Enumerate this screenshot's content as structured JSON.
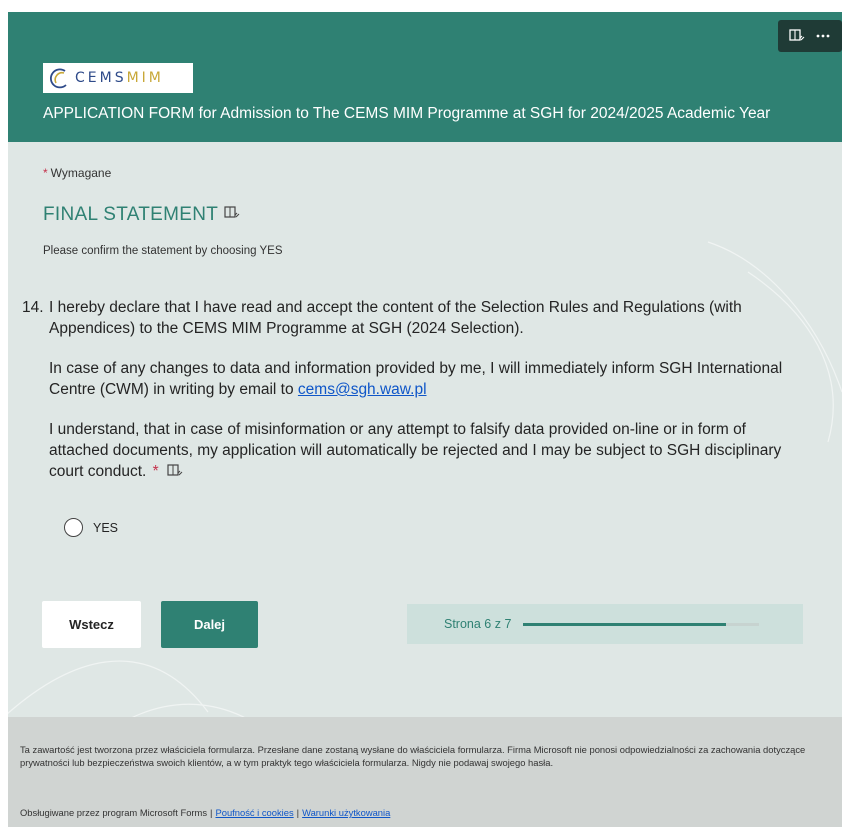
{
  "header": {
    "logo": {
      "cems": "CEMS",
      "mim": "MIM"
    },
    "title": "APPLICATION FORM for Admission to The CEMS MIM Programme at SGH for 2024/2025 Academic Year",
    "tools": {
      "immersive_reader_icon": "immersive-reader-icon",
      "more_icon": "more-options-icon"
    }
  },
  "form": {
    "required_star": "*",
    "required_note": "Wymagane",
    "section_title": "FINAL STATEMENT",
    "section_description": "Please confirm the statement by choosing YES",
    "question": {
      "number": "14.",
      "paragraph1": "I hereby declare that I have read and accept the content of the Selection Rules and Regulations (with Appendices) to the CEMS MIM Programme at SGH (2024 Selection).",
      "paragraph2_prefix": "In case of any changes to data and information provided by me, I will immediately inform SGH International Centre (CWM) in writing by email to",
      "paragraph2_link": "cems@sgh.waw.pl",
      "paragraph3": "I understand, that in case of misinformation or any attempt to falsify data provided on-line or in form of attached documents, my application will automatically be rejected and I may be subject to SGH disciplinary court conduct.",
      "required_star": "*",
      "options": [
        {
          "label": "YES",
          "selected": false
        }
      ]
    }
  },
  "navigation": {
    "back_label": "Wstecz",
    "next_label": "Dalej",
    "progress_text": "Strona 6 z 7",
    "current_page": 6,
    "total_pages": 7
  },
  "footer": {
    "disclaimer": "Ta zawartość jest tworzona przez właściciela formularza. Przesłane dane zostaną wysłane do właściciela formularza. Firma Microsoft nie ponosi odpowiedzialności za zachowania dotyczące prywatności lub bezpieczeństwa swoich klientów, a w tym praktyk tego właściciela formularza. Nigdy nie podawaj swojego hasła.",
    "powered_by": "Obsługiwane przez program Microsoft Forms",
    "separator": "|",
    "privacy_link": "Poufność i cookies",
    "terms_link": "Warunki użytkowania"
  },
  "colors": {
    "accent": "#2f8173",
    "header_tools_bg": "#1f3b36",
    "page_bg": "#dfe7e5",
    "footer_bg": "#d0d4d2",
    "required": "#c4314b",
    "link": "#0f56c8"
  }
}
